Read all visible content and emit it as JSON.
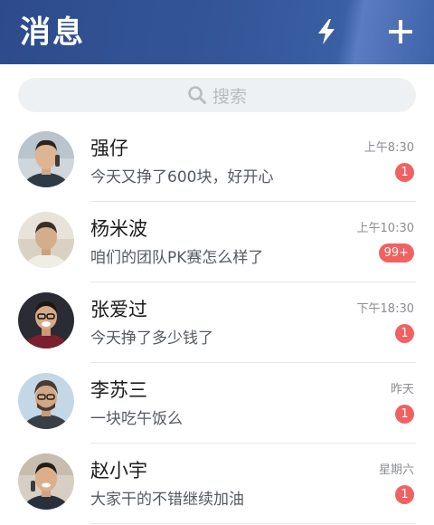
{
  "header": {
    "title": "消息",
    "accent": "#2d4b8c"
  },
  "search": {
    "placeholder": "搜索"
  },
  "conversations": [
    {
      "name": "强仔",
      "message": "今天又挣了600块，好开心",
      "time": "上午8:30",
      "unread": "1"
    },
    {
      "name": "杨米波",
      "message": "咱们的团队PK赛怎么样了",
      "time": "上午10:30",
      "unread": "99+"
    },
    {
      "name": "张爱过",
      "message": "今天挣了多少钱了",
      "time": "下午18:30",
      "unread": "1"
    },
    {
      "name": "李苏三",
      "message": "一块吃午饭么",
      "time": "昨天",
      "unread": "1"
    },
    {
      "name": "赵小宇",
      "message": "大家干的不错继续加油",
      "time": "星期六",
      "unread": "1"
    }
  ],
  "colors": {
    "badge": "#f26161",
    "search_bg": "#eef1f3"
  }
}
